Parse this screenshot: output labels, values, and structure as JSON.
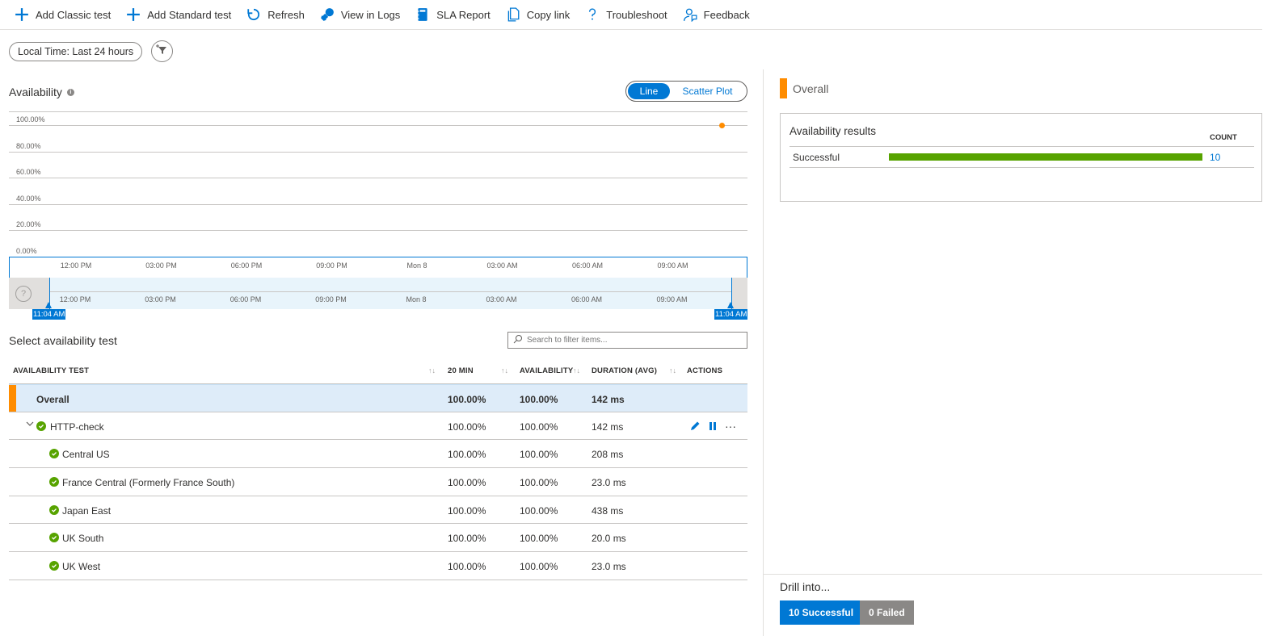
{
  "toolbar": {
    "items": [
      {
        "label": "Add Classic test",
        "icon": "plus-icon"
      },
      {
        "label": "Add Standard test",
        "icon": "plus-icon"
      },
      {
        "label": "Refresh",
        "icon": "refresh-icon"
      },
      {
        "label": "View in Logs",
        "icon": "logs-icon"
      },
      {
        "label": "SLA Report",
        "icon": "notebook-icon"
      },
      {
        "label": "Copy link",
        "icon": "copy-icon"
      },
      {
        "label": "Troubleshoot",
        "icon": "question-icon"
      },
      {
        "label": "Feedback",
        "icon": "feedback-icon"
      }
    ]
  },
  "filters": {
    "time_range": "Local Time: Last 24 hours"
  },
  "availability": {
    "title": "Availability",
    "toggle": {
      "line": "Line",
      "scatter": "Scatter Plot",
      "selected": "Line"
    }
  },
  "chart_data": {
    "type": "scatter",
    "title": "",
    "xlabel": "",
    "ylabel": "",
    "yticks": [
      "100.00%",
      "80.00%",
      "60.00%",
      "40.00%",
      "20.00%",
      "0.00%"
    ],
    "ylim": [
      0,
      100
    ],
    "xticks": [
      "12:00 PM",
      "03:00 PM",
      "06:00 PM",
      "09:00 PM",
      "Mon 8",
      "03:00 AM",
      "06:00 AM",
      "09:00 AM"
    ],
    "series": [
      {
        "color": "#ff8c00",
        "points": [
          {
            "x": "10:45 AM",
            "y": 100
          }
        ]
      }
    ],
    "brush": {
      "start": "11:04 AM",
      "end": "11:04 AM"
    },
    "grid": true
  },
  "tests": {
    "title": "Select availability test",
    "search_placeholder": "Search to filter items...",
    "columns": [
      "AVAILABILITY TEST",
      "20 MIN",
      "AVAILABILITY",
      "DURATION (AVG)",
      "ACTIONS"
    ],
    "rows": [
      {
        "name": "Overall",
        "min20": "100.00%",
        "availability": "100.00%",
        "duration": "142 ms"
      },
      {
        "name": "HTTP-check",
        "min20": "100.00%",
        "availability": "100.00%",
        "duration": "142 ms"
      },
      {
        "name": "Central US",
        "min20": "100.00%",
        "availability": "100.00%",
        "duration": "208 ms"
      },
      {
        "name": "France Central (Formerly France South)",
        "min20": "100.00%",
        "availability": "100.00%",
        "duration": "23.0 ms"
      },
      {
        "name": "Japan East",
        "min20": "100.00%",
        "availability": "100.00%",
        "duration": "438 ms"
      },
      {
        "name": "UK South",
        "min20": "100.00%",
        "availability": "100.00%",
        "duration": "20.0 ms"
      },
      {
        "name": "UK West",
        "min20": "100.00%",
        "availability": "100.00%",
        "duration": "23.0 ms"
      }
    ]
  },
  "right": {
    "legend": "Overall",
    "results": {
      "title": "Availability results",
      "count_header": "COUNT",
      "items": [
        {
          "label": "Successful",
          "count": "10",
          "fraction": 1.0,
          "color": "#57a300"
        }
      ]
    },
    "drill": {
      "title": "Drill into...",
      "successful": "10 Successful",
      "failed": "0 Failed"
    }
  },
  "colors": {
    "accent": "#0078d4",
    "success": "#57a300",
    "overall": "#ff8c00"
  }
}
